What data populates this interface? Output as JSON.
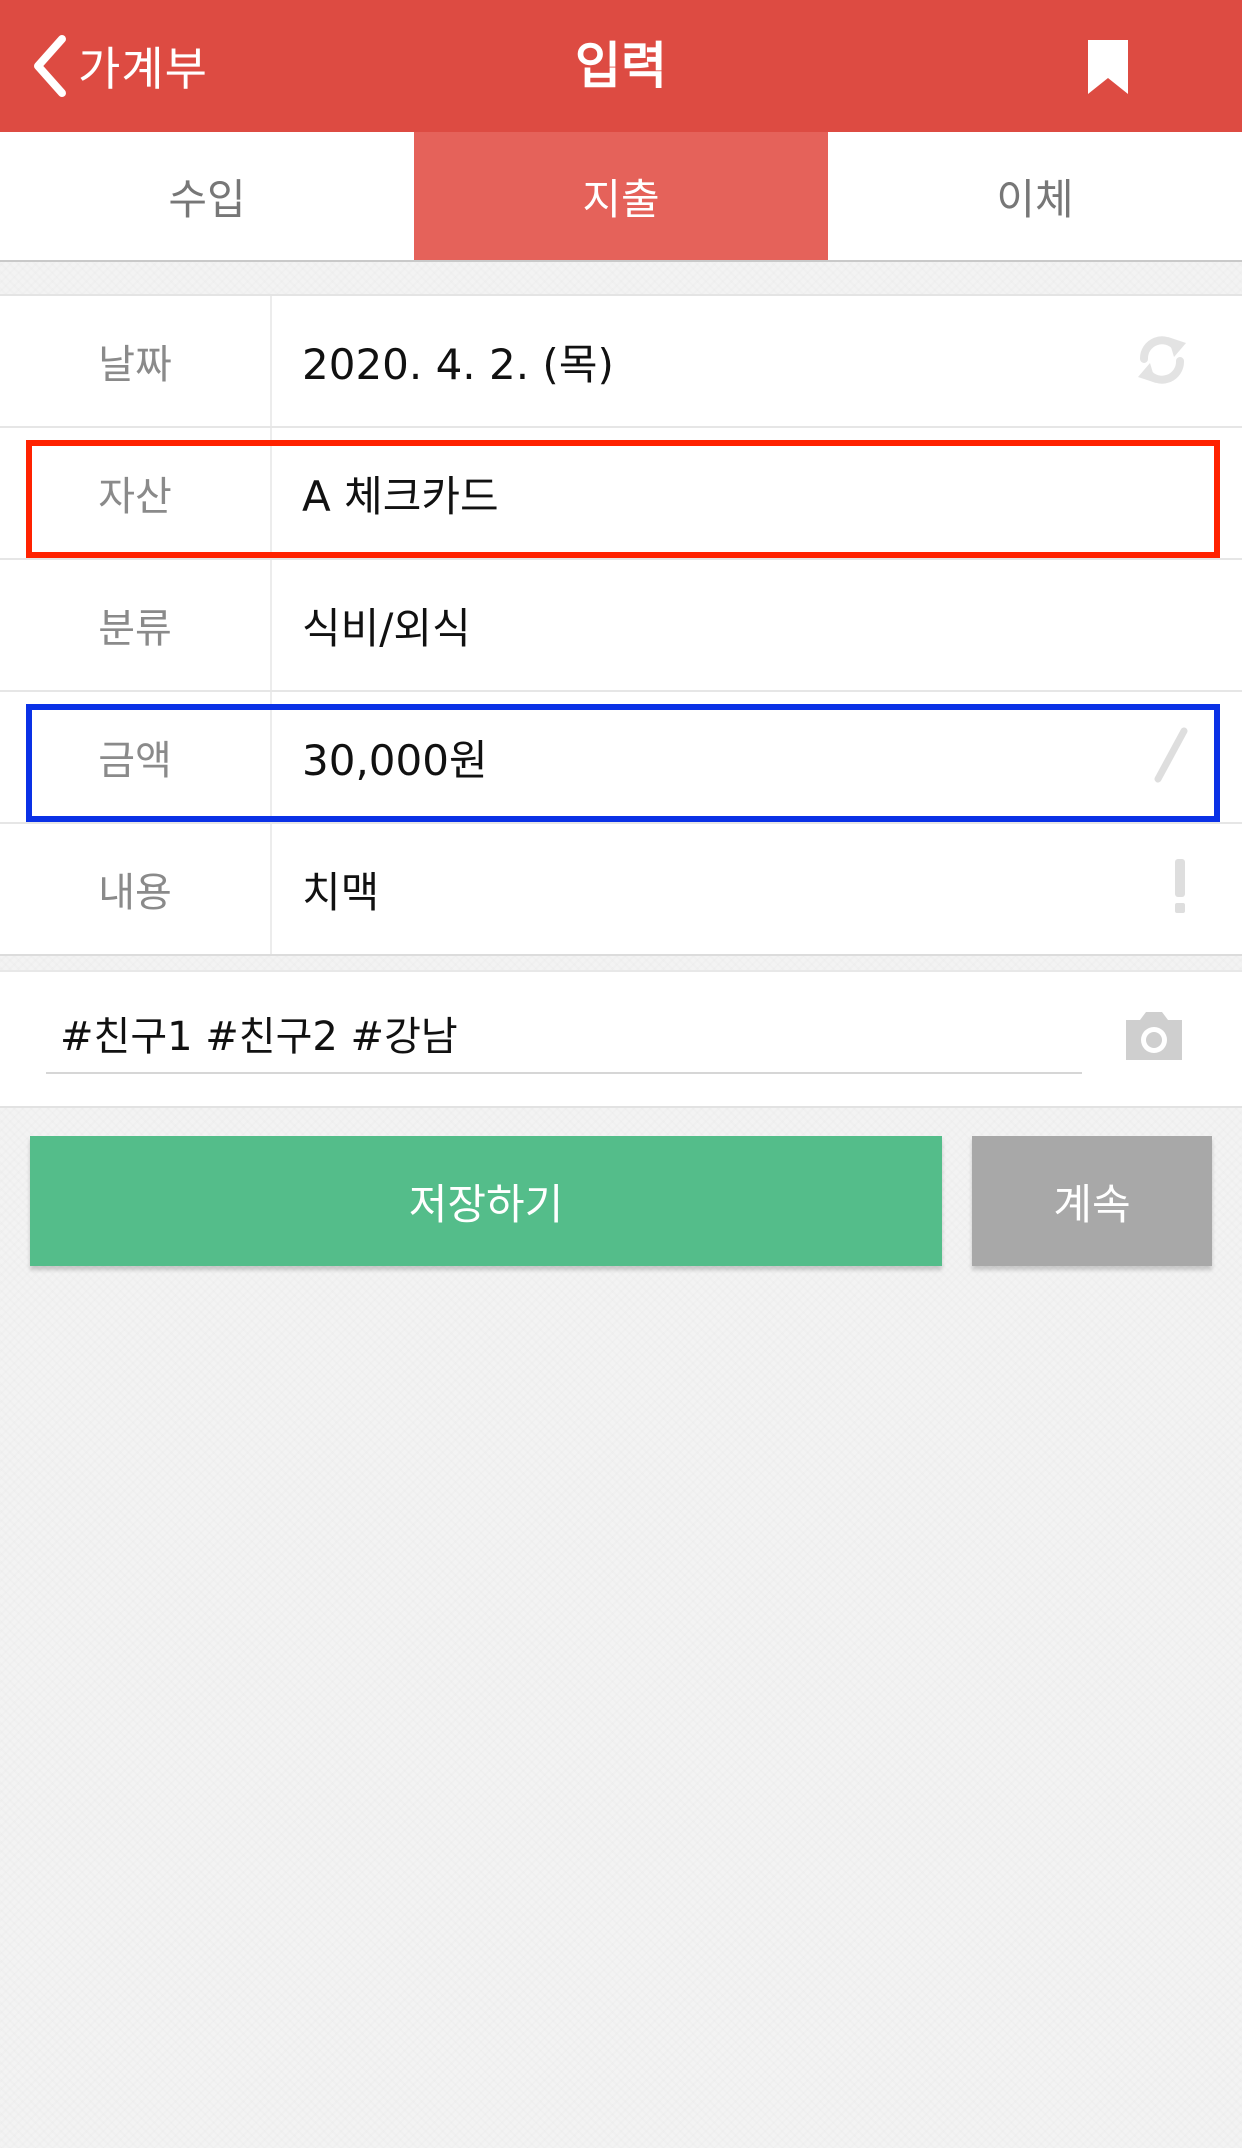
{
  "header": {
    "back_label": "가계부",
    "title": "입력",
    "background_color": "#dd4b42"
  },
  "tabs": [
    {
      "label": "수입",
      "selected": false
    },
    {
      "label": "지출",
      "selected": true
    },
    {
      "label": "이체",
      "selected": false
    }
  ],
  "form": {
    "date": {
      "label": "날짜",
      "value": "2020. 4. 2. (목)",
      "icon": "refresh-icon"
    },
    "asset": {
      "label": "자산",
      "value": "A 체크카드"
    },
    "category": {
      "label": "분류",
      "value": "식비/외식"
    },
    "amount": {
      "label": "금액",
      "value": "30,000원",
      "icon": "pencil-icon"
    },
    "content": {
      "label": "내용",
      "value": "치맥",
      "icon": "exclamation-icon"
    }
  },
  "memo": {
    "value": "#친구1 #친구2 #강남",
    "icon": "camera-icon"
  },
  "actions": {
    "save_label": "저장하기",
    "continue_label": "계속",
    "save_color": "#54bd8a",
    "continue_color": "#a8a8a8"
  },
  "highlights": {
    "red_color": "#ff2200",
    "blue_color": "#0a31e6"
  }
}
